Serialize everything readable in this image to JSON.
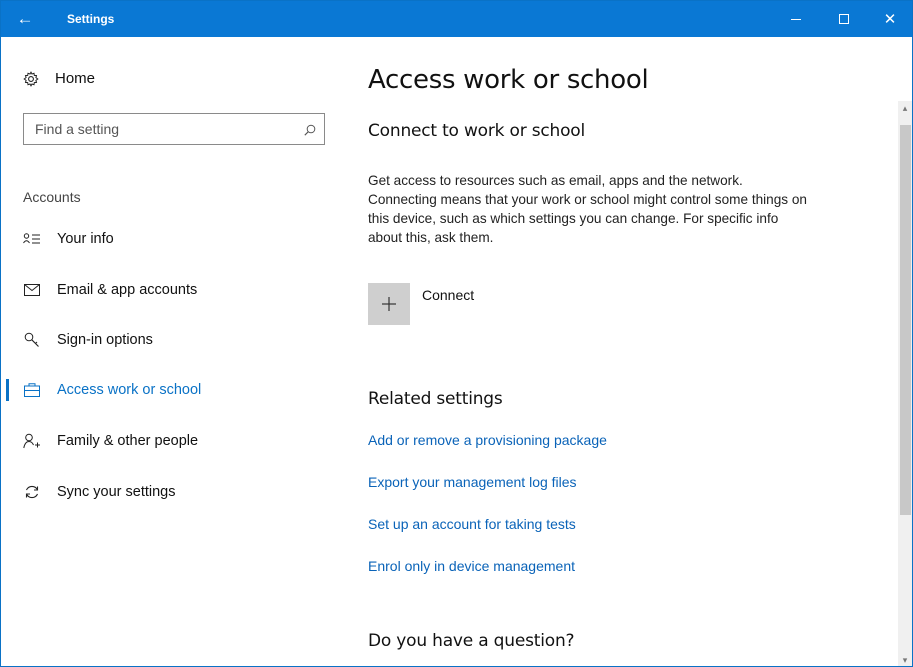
{
  "window": {
    "title": "Settings",
    "back_icon": "←",
    "accent": "#0a78d4",
    "close_glyph": "✕"
  },
  "sidebar": {
    "home_label": "Home",
    "home_icon": "gear-icon",
    "search_placeholder": "Find a setting",
    "section": "Accounts",
    "items": [
      {
        "label": "Your info",
        "icon": "person-list-icon",
        "glyph": "Θ≡",
        "active": false
      },
      {
        "label": "Email & app accounts",
        "icon": "mail-icon",
        "glyph": "✉",
        "active": false
      },
      {
        "label": "Sign-in options",
        "icon": "key-icon",
        "glyph": "⌕",
        "active": false
      },
      {
        "label": "Access work or school",
        "icon": "briefcase-icon",
        "glyph": "▤",
        "active": true
      },
      {
        "label": "Family & other people",
        "icon": "add-person-icon",
        "glyph": "μ",
        "active": false
      },
      {
        "label": "Sync your settings",
        "icon": "sync-icon",
        "glyph": "↻",
        "active": false
      }
    ]
  },
  "main": {
    "title": "Access work or school",
    "connect_heading": "Connect to work or school",
    "description": "Get access to resources such as email, apps and the network. Connecting means that your work or school might control some things on this device, such as which settings you can change. For specific info about this, ask them.",
    "connect_label": "Connect",
    "connect_glyph": "+",
    "related_heading": "Related settings",
    "related_links": [
      "Add or remove a provisioning package",
      "Export your management log files",
      "Set up an account for taking tests",
      "Enrol only in device management"
    ],
    "question_heading": "Do you have a question?"
  }
}
